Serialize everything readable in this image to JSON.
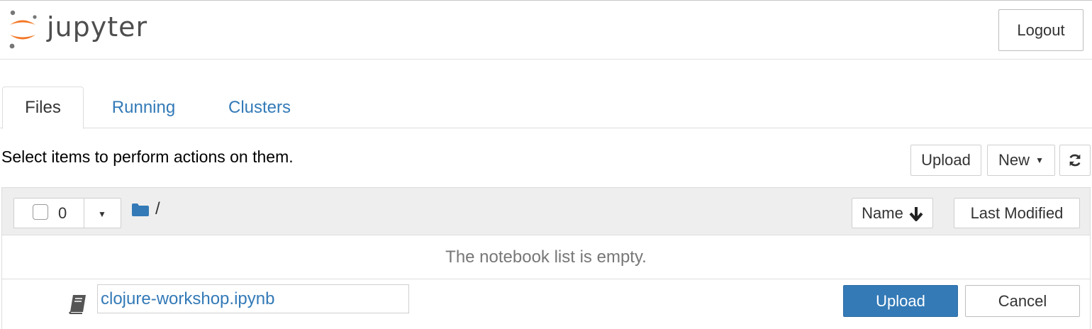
{
  "header": {
    "logo_text": "jupyter",
    "logout_label": "Logout"
  },
  "tabs": [
    {
      "label": "Files",
      "active": true
    },
    {
      "label": "Running",
      "active": false
    },
    {
      "label": "Clusters",
      "active": false
    }
  ],
  "toolbar": {
    "instructions": "Select items to perform actions on them.",
    "upload_label": "Upload",
    "new_label": "New",
    "new_icon": "caret-down-icon",
    "refresh_icon": "refresh-icon"
  },
  "list": {
    "selected_count": "0",
    "breadcrumb_root": "/",
    "sort_name_label": "Name",
    "sort_name_icon": "arrow-down-icon",
    "sort_modified_label": "Last Modified",
    "empty_message": "The notebook list is empty."
  },
  "upload_row": {
    "filename_value": "clojure-workshop.ipynb",
    "upload_label": "Upload",
    "cancel_label": "Cancel",
    "file_icon": "notebook-icon"
  },
  "colors": {
    "accent": "#337ab7",
    "logo_orange": "#f37726",
    "logo_gray": "#767677"
  }
}
